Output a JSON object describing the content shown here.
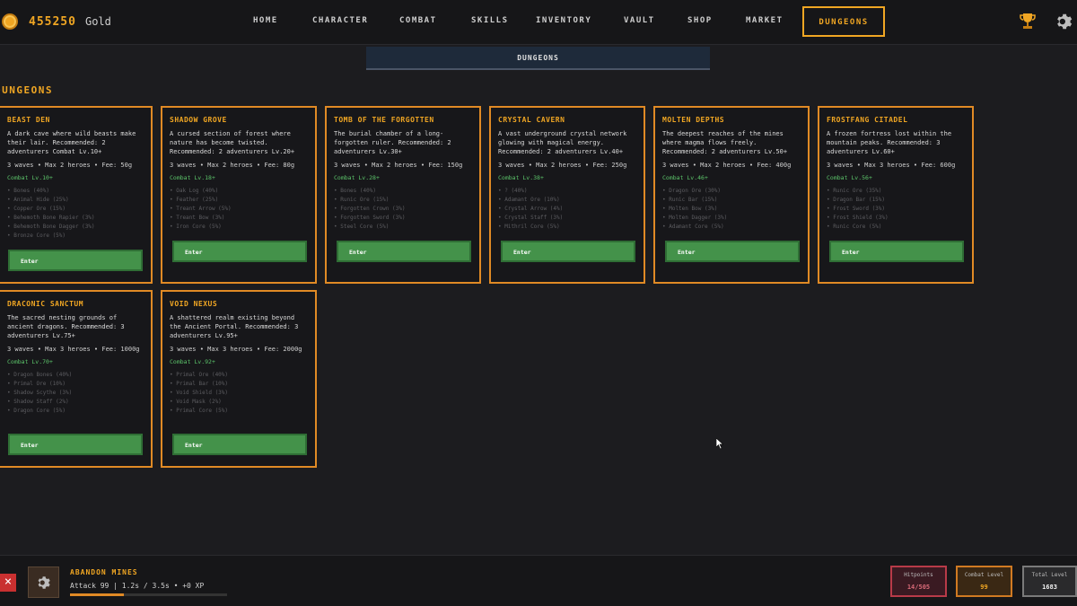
{
  "header": {
    "gold_amount": "455250",
    "gold_label": "Gold",
    "nav": [
      "HOME",
      "CHARACTER",
      "COMBAT",
      "SKILLS",
      "INVENTORY",
      "VAULT",
      "SHOP",
      "MARKET",
      "DUNGEONS"
    ],
    "active_nav": "DUNGEONS"
  },
  "subtab": {
    "label": "DUNGEONS"
  },
  "section_title": "DUNGEONS",
  "enter_label": "Enter",
  "dungeons": [
    {
      "name": "BEAST DEN",
      "description": "A dark cave where wild beasts make their lair. Recommended: 2 adventurers Combat Lv.10+",
      "info": "3 waves • Max 2 heroes • Fee: 50g",
      "requirement": "Combat Lv.10+",
      "loot": [
        "• Bones (40%)",
        "• Animal Hide (25%)",
        "• Copper Ore (15%)",
        "• Behemoth Bone Rapier (3%)",
        "• Behemoth Bone Dagger (3%)",
        "• Bronze Core (5%)"
      ]
    },
    {
      "name": "SHADOW GROVE",
      "description": "A cursed section of forest where nature has become twisted. Recommended: 2 adventurers Lv.20+",
      "info": "3 waves • Max 2 heroes • Fee: 80g",
      "requirement": "Combat Lv.18+",
      "loot": [
        "• Oak Log (40%)",
        "• Feather (25%)",
        "• Treant Arrow (5%)",
        "• Treant Bow (3%)",
        "• Iron Core (5%)"
      ]
    },
    {
      "name": "TOMB OF THE FORGOTTEN",
      "description": "The burial chamber of a long-forgotten ruler. Recommended: 2 adventurers Lv.30+",
      "info": "3 waves • Max 2 heroes • Fee: 150g",
      "requirement": "Combat Lv.28+",
      "loot": [
        "• Bones (40%)",
        "• Runic Ore (15%)",
        "• Forgotten Crown (3%)",
        "• Forgotten Sword (3%)",
        "• Steel Core (5%)"
      ]
    },
    {
      "name": "CRYSTAL CAVERN",
      "description": "A vast underground crystal network glowing with magical energy. Recommended: 2 adventurers Lv.40+",
      "info": "3 waves • Max 2 heroes • Fee: 250g",
      "requirement": "Combat Lv.38+",
      "loot": [
        "• ? (40%)",
        "• Adamant Ore (10%)",
        "• Crystal Arrow (4%)",
        "• Crystal Staff (3%)",
        "• Mithril Core (5%)"
      ]
    },
    {
      "name": "MOLTEN DEPTHS",
      "description": "The deepest reaches of the mines where magma flows freely. Recommended: 2 adventurers Lv.50+",
      "info": "3 waves • Max 2 heroes • Fee: 400g",
      "requirement": "Combat Lv.46+",
      "loot": [
        "• Dragon Ore (30%)",
        "• Runic Bar (15%)",
        "• Molten Bow (3%)",
        "• Molten Dagger (3%)",
        "• Adamant Core (5%)"
      ]
    },
    {
      "name": "FROSTFANG CITADEL",
      "description": "A frozen fortress lost within the mountain peaks. Recommended: 3 adventurers Lv.60+",
      "info": "3 waves • Max 3 heroes • Fee: 600g",
      "requirement": "Combat Lv.56+",
      "loot": [
        "• Runic Ore (35%)",
        "• Dragon Bar (15%)",
        "• Frost Sword (3%)",
        "• Frost Shield (3%)",
        "• Runic Core (5%)"
      ]
    },
    {
      "name": "DRACONIC SANCTUM",
      "description": "The sacred nesting grounds of ancient dragons. Recommended: 3 adventurers Lv.75+",
      "info": "3 waves • Max 3 heroes • Fee: 1000g",
      "requirement": "Combat Lv.70+",
      "loot": [
        "• Dragon Bones (40%)",
        "• Primal Ore (10%)",
        "• Shadow Scythe (3%)",
        "• Shadow Staff (2%)",
        "• Dragon Core (5%)"
      ]
    },
    {
      "name": "VOID NEXUS",
      "description": "A shattered realm existing beyond the Ancient Portal. Recommended: 3 adventurers Lv.95+",
      "info": "3 waves • Max 3 heroes • Fee: 2000g",
      "requirement": "Combat Lv.92+",
      "loot": [
        "• Primal Ore (40%)",
        "• Primal Bar (10%)",
        "• Void Shield (3%)",
        "• Void Mask (2%)",
        "• Primal Core (5%)"
      ]
    }
  ],
  "footer": {
    "close_label": "×",
    "action_name": "ABANDON MINES",
    "action_stats": "Attack 99 | 1.2s / 3.5s • +0 XP",
    "action_progress": 0.34,
    "hitpoints_label": "Hitpoints",
    "hitpoints_value": "14/505",
    "combat_level_label": "Combat Level",
    "combat_level_value": "99",
    "total_level_label": "Total Level",
    "total_level_value": "1683"
  },
  "colors": {
    "accent": "#f0a623",
    "card_border": "#e08a25",
    "enter_button": "#44924a",
    "requirement_text": "#5cc46a"
  },
  "icons": [
    "coin-icon",
    "trophy-icon",
    "gear-icon",
    "close-icon",
    "action-gear-icon",
    "cursor-icon"
  ]
}
